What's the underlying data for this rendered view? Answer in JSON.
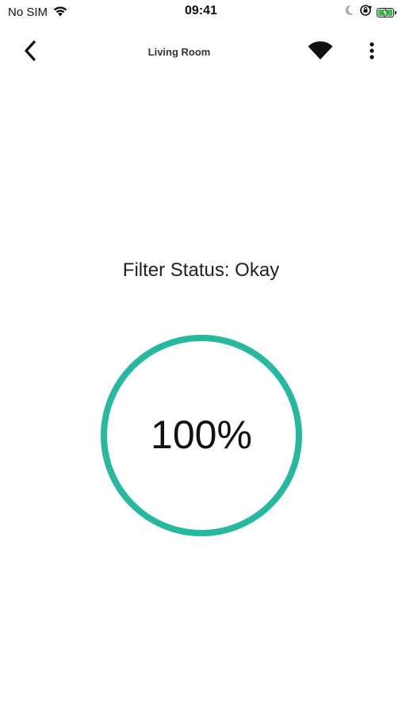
{
  "status_bar": {
    "carrier": "No SIM",
    "time": "09:41",
    "icons": [
      "wifi-icon",
      "moon-icon",
      "orientation-lock-icon",
      "battery-charging-icon"
    ],
    "battery_color": "#37c24b"
  },
  "nav": {
    "title": "Living Room",
    "back_icon": "chevron-left-icon",
    "wifi_icon": "wifi-icon",
    "more_icon": "more-vertical-icon"
  },
  "filter": {
    "status_text": "Filter Status: Okay",
    "percent_text": "100%",
    "percent_value": 100,
    "ring_color": "#26b9a0"
  }
}
